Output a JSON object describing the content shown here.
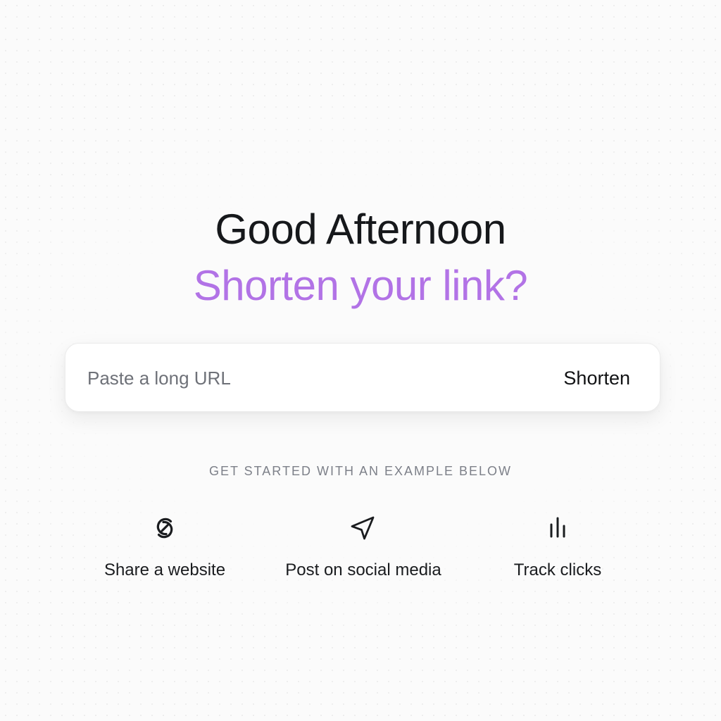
{
  "header": {
    "greeting": "Good Afternoon",
    "prompt": "Shorten your link?"
  },
  "search": {
    "placeholder": "Paste a long URL",
    "value": "",
    "button_label": "Shorten"
  },
  "examples": {
    "heading": "GET STARTED WITH AN EXAMPLE BELOW",
    "items": [
      {
        "label": "Share a website",
        "icon": "link-icon"
      },
      {
        "label": "Post on social media",
        "icon": "send-icon"
      },
      {
        "label": "Track clicks",
        "icon": "bar-chart-icon"
      }
    ]
  },
  "colors": {
    "accent": "#b273e6",
    "text": "#16181b",
    "muted": "#7d8089",
    "background": "#fbfbfb"
  }
}
